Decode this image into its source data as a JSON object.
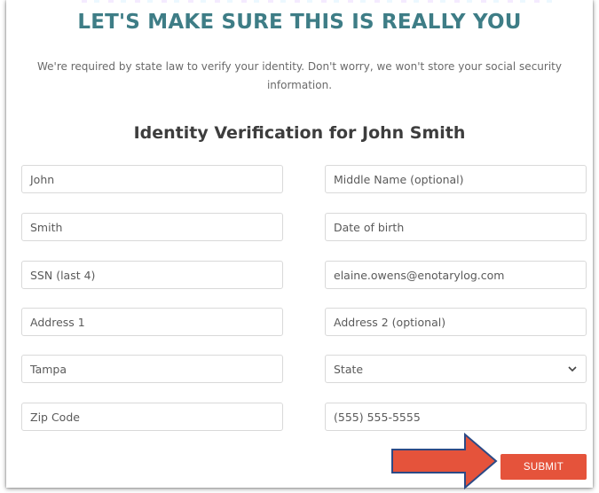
{
  "header": {
    "title": "LET'S MAKE SURE THIS IS REALLY YOU",
    "subtitle": "We're required by state law to verify your identity. Don't worry, we won't store your social security information."
  },
  "form": {
    "heading": "Identity Verification for John Smith",
    "first_name": "John",
    "middle_name_placeholder": "Middle Name (optional)",
    "last_name": "Smith",
    "dob_placeholder": "Date of birth",
    "ssn_placeholder": "SSN (last 4)",
    "email": "elaine.owens@enotarylog.com",
    "address1_placeholder": "Address 1",
    "address2_placeholder": "Address 2 (optional)",
    "city": "Tampa",
    "state_selected": "State",
    "zip_placeholder": "Zip Code",
    "phone": "(555) 555-5555",
    "submit_label": "SUBMIT"
  },
  "colors": {
    "title": "#3e7d86",
    "submit": "#e5533b",
    "arrow_fill": "#e5533b",
    "arrow_stroke": "#2c4a86"
  },
  "icons": {
    "state_dropdown": "chevron-down-icon",
    "annotation": "arrow-right-icon"
  }
}
